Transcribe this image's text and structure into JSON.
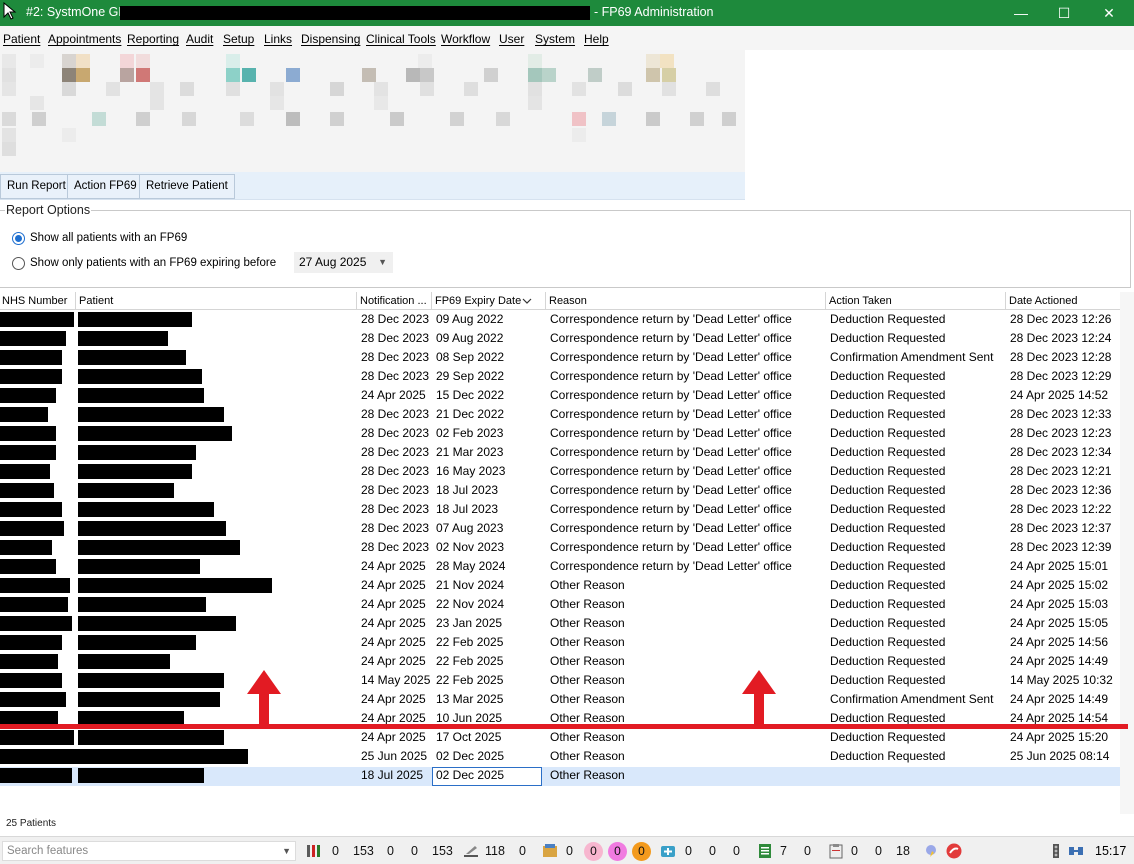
{
  "window": {
    "title_prefix": "#2: SystmOne GP:",
    "title_suffix": "- FP69 Administration",
    "minimize": "—",
    "maximize": "☐",
    "close": "✕"
  },
  "menu": [
    "Patient",
    "Appointments",
    "Reporting",
    "Audit",
    "Setup",
    "Links",
    "Dispensing",
    "Clinical Tools",
    "Workflow",
    "User",
    "System",
    "Help"
  ],
  "actions": {
    "run_report": "Run Report",
    "action_fp69": "Action FP69",
    "retrieve_patient": "Retrieve Patient"
  },
  "report_options": {
    "title": "Report Options",
    "option_all": "Show all patients with an FP69",
    "option_expiring": "Show only patients with an FP69 expiring before",
    "selected": "all",
    "expiry_date": "27 Aug 2025"
  },
  "grid": {
    "columns": {
      "nhs": "NHS Number",
      "patient": "Patient",
      "notification": "Notification ...",
      "expiry": "FP69 Expiry Date",
      "reason": "Reason",
      "action": "Action Taken",
      "date_actioned": "Date Actioned"
    },
    "sort_icon": "chevron-down-icon",
    "rows": [
      {
        "notification": "28 Dec 2023",
        "expiry": "09 Aug 2022",
        "reason": "Correspondence return by 'Dead Letter' office",
        "action": "Deduction Requested",
        "date_actioned": "28 Dec 2023 12:26"
      },
      {
        "notification": "28 Dec 2023",
        "expiry": "09 Aug 2022",
        "reason": "Correspondence return by 'Dead Letter' office",
        "action": "Deduction Requested",
        "date_actioned": "28 Dec 2023 12:24"
      },
      {
        "notification": "28 Dec 2023",
        "expiry": "08 Sep 2022",
        "reason": "Correspondence return by 'Dead Letter' office",
        "action": "Confirmation Amendment Sent",
        "date_actioned": "28 Dec 2023 12:28"
      },
      {
        "notification": "28 Dec 2023",
        "expiry": "29 Sep 2022",
        "reason": "Correspondence return by 'Dead Letter' office",
        "action": "Deduction Requested",
        "date_actioned": "28 Dec 2023 12:29"
      },
      {
        "notification": "24 Apr 2025",
        "expiry": "15 Dec 2022",
        "reason": "Correspondence return by 'Dead Letter' office",
        "action": "Deduction Requested",
        "date_actioned": "24 Apr 2025 14:52"
      },
      {
        "notification": "28 Dec 2023",
        "expiry": "21 Dec 2022",
        "reason": "Correspondence return by 'Dead Letter' office",
        "action": "Deduction Requested",
        "date_actioned": "28 Dec 2023 12:33"
      },
      {
        "notification": "28 Dec 2023",
        "expiry": "02 Feb 2023",
        "reason": "Correspondence return by 'Dead Letter' office",
        "action": "Deduction Requested",
        "date_actioned": "28 Dec 2023 12:23"
      },
      {
        "notification": "28 Dec 2023",
        "expiry": "21 Mar 2023",
        "reason": "Correspondence return by 'Dead Letter' office",
        "action": "Deduction Requested",
        "date_actioned": "28 Dec 2023 12:34"
      },
      {
        "notification": "28 Dec 2023",
        "expiry": "16 May 2023",
        "reason": "Correspondence return by 'Dead Letter' office",
        "action": "Deduction Requested",
        "date_actioned": "28 Dec 2023 12:21"
      },
      {
        "notification": "28 Dec 2023",
        "expiry": "18 Jul 2023",
        "reason": "Correspondence return by 'Dead Letter' office",
        "action": "Deduction Requested",
        "date_actioned": "28 Dec 2023 12:36"
      },
      {
        "notification": "28 Dec 2023",
        "expiry": "18 Jul 2023",
        "reason": "Correspondence return by 'Dead Letter' office",
        "action": "Deduction Requested",
        "date_actioned": "28 Dec 2023 12:22"
      },
      {
        "notification": "28 Dec 2023",
        "expiry": "07 Aug 2023",
        "reason": "Correspondence return by 'Dead Letter' office",
        "action": "Deduction Requested",
        "date_actioned": "28 Dec 2023 12:37"
      },
      {
        "notification": "28 Dec 2023",
        "expiry": "02 Nov 2023",
        "reason": "Correspondence return by 'Dead Letter' office",
        "action": "Deduction Requested",
        "date_actioned": "28 Dec 2023 12:39"
      },
      {
        "notification": "24 Apr 2025",
        "expiry": "28 May 2024",
        "reason": "Correspondence return by 'Dead Letter' office",
        "action": "Deduction Requested",
        "date_actioned": "24 Apr 2025 15:01"
      },
      {
        "notification": "24 Apr 2025",
        "expiry": "21 Nov 2024",
        "reason": "Other Reason",
        "action": "Deduction Requested",
        "date_actioned": "24 Apr 2025 15:02"
      },
      {
        "notification": "24 Apr 2025",
        "expiry": "22 Nov 2024",
        "reason": "Other Reason",
        "action": "Deduction Requested",
        "date_actioned": "24 Apr 2025 15:03"
      },
      {
        "notification": "24 Apr 2025",
        "expiry": "23 Jan 2025",
        "reason": "Other Reason",
        "action": "Deduction Requested",
        "date_actioned": "24 Apr 2025 15:05"
      },
      {
        "notification": "24 Apr 2025",
        "expiry": "22 Feb 2025",
        "reason": "Other Reason",
        "action": "Deduction Requested",
        "date_actioned": "24 Apr 2025 14:56"
      },
      {
        "notification": "24 Apr 2025",
        "expiry": "22 Feb 2025",
        "reason": "Other Reason",
        "action": "Deduction Requested",
        "date_actioned": "24 Apr 2025 14:49"
      },
      {
        "notification": "14 May 2025",
        "expiry": "22 Feb 2025",
        "reason": "Other Reason",
        "action": "Deduction Requested",
        "date_actioned": "14 May 2025 10:32"
      },
      {
        "notification": "24 Apr 2025",
        "expiry": "13 Mar 2025",
        "reason": "Other Reason",
        "action": "Confirmation Amendment Sent",
        "date_actioned": "24 Apr 2025 14:49"
      },
      {
        "notification": "24 Apr 2025",
        "expiry": "10 Jun 2025",
        "reason": "Other Reason",
        "action": "Deduction Requested",
        "date_actioned": "24 Apr 2025 14:54"
      },
      {
        "notification": "24 Apr 2025",
        "expiry": "17 Oct 2025",
        "reason": "Other Reason",
        "action": "Deduction Requested",
        "date_actioned": "24 Apr 2025 15:20"
      },
      {
        "notification": "25 Jun 2025",
        "expiry": "02 Dec 2025",
        "reason": "Other Reason",
        "action": "Deduction Requested",
        "date_actioned": "25 Jun 2025 08:14"
      },
      {
        "notification": "18 Jul 2025",
        "expiry": "02 Dec 2025",
        "reason": "Other Reason",
        "action": "",
        "date_actioned": ""
      }
    ],
    "selected_row": 24
  },
  "status": {
    "patient_count": "25 Patients",
    "search_placeholder": "Search features",
    "counters": [
      "0",
      "153",
      "0",
      "0",
      "153",
      "118",
      "0",
      "0",
      "0",
      "0",
      "0",
      "0",
      "0",
      "0",
      "7",
      "0",
      "0",
      "0",
      "18"
    ],
    "time": "15:17"
  },
  "colors": {
    "titlebar": "#1e8a3c",
    "annotation": "#e21b23",
    "selection": "#d9e8fb",
    "badge_pink": "#f7b6cf",
    "badge_magenta": "#f07be0",
    "badge_orange": "#f39a1d"
  }
}
